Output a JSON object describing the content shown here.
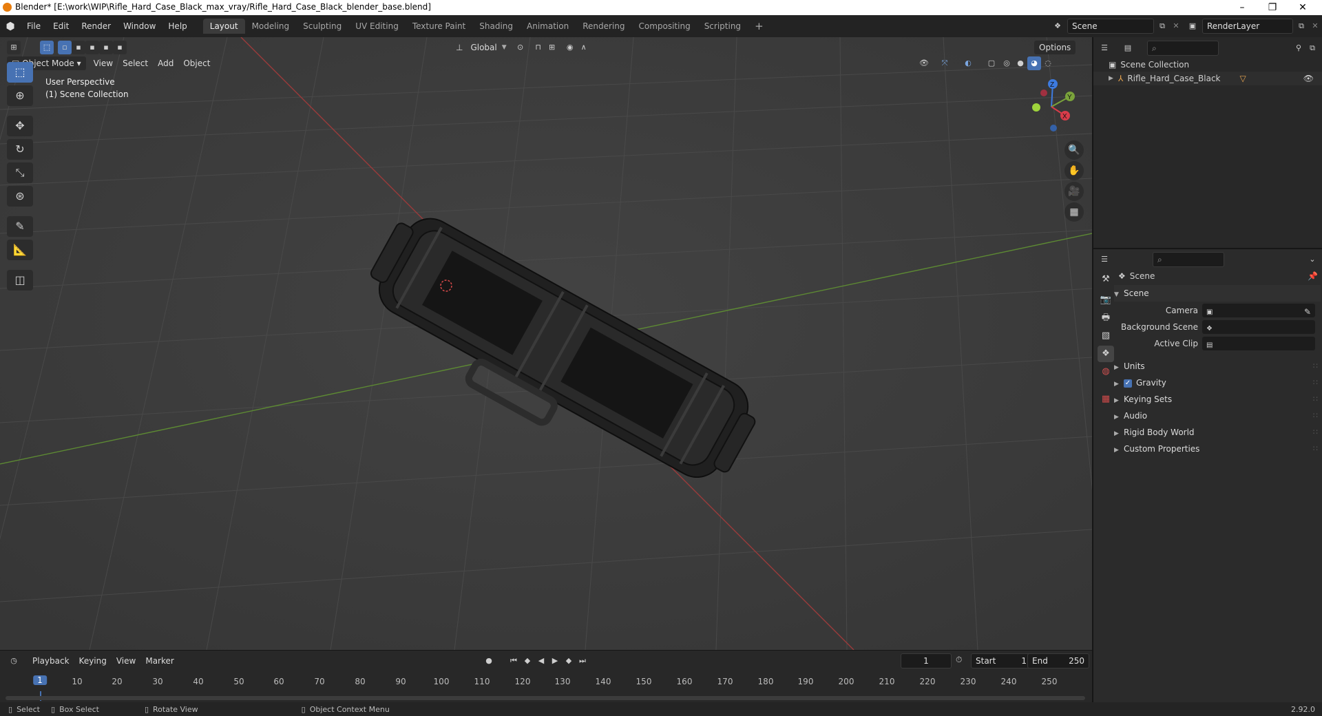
{
  "window": {
    "title": "Blender* [E:\\work\\WIP\\Rifle_Hard_Case_Black_max_vray/Rifle_Hard_Case_Black_blender_base.blend]",
    "minimize": "–",
    "restore": "❐",
    "close": "✕"
  },
  "menus": [
    "File",
    "Edit",
    "Render",
    "Window",
    "Help"
  ],
  "workspaces": {
    "tabs": [
      "Layout",
      "Modeling",
      "Sculpting",
      "UV Editing",
      "Texture Paint",
      "Shading",
      "Animation",
      "Rendering",
      "Compositing",
      "Scripting"
    ],
    "active": "Layout",
    "add": "+"
  },
  "scene_selector": {
    "value": "Scene"
  },
  "render_layer_selector": {
    "value": "RenderLayer"
  },
  "viewport": {
    "mode": "Object Mode",
    "header_menus": [
      "View",
      "Select",
      "Add",
      "Object"
    ],
    "orientation": "Global",
    "options": "Options",
    "info_line1": "User Perspective",
    "info_line2": "(1) Scene Collection",
    "gizmo": {
      "x": "X",
      "y": "Y",
      "z": "Z"
    }
  },
  "outliner": {
    "root": "Scene Collection",
    "items": [
      {
        "label": "Rifle_Hard_Case_Black"
      }
    ]
  },
  "properties": {
    "breadcrumb": "Scene",
    "section": "Scene",
    "fields": [
      {
        "label": "Camera",
        "value": ""
      },
      {
        "label": "Background Scene",
        "value": ""
      },
      {
        "label": "Active Clip",
        "value": ""
      }
    ],
    "panels": [
      {
        "label": "Units",
        "checkbox": false
      },
      {
        "label": "Gravity",
        "checkbox": true,
        "checked": true
      },
      {
        "label": "Keying Sets",
        "checkbox": false
      },
      {
        "label": "Audio",
        "checkbox": false
      },
      {
        "label": "Rigid Body World",
        "checkbox": false
      },
      {
        "label": "Custom Properties",
        "checkbox": false
      }
    ]
  },
  "timeline": {
    "menus": [
      "Playback",
      "Keying",
      "View",
      "Marker"
    ],
    "current_frame": "1",
    "start_label": "Start",
    "start": "1",
    "end_label": "End",
    "end": "250",
    "ticks": [
      "1",
      "10",
      "20",
      "30",
      "40",
      "50",
      "60",
      "70",
      "80",
      "90",
      "100",
      "110",
      "120",
      "130",
      "140",
      "150",
      "160",
      "170",
      "180",
      "190",
      "200",
      "210",
      "220",
      "230",
      "240",
      "250"
    ]
  },
  "statusbar": {
    "select": "Select",
    "box_select": "Box Select",
    "rotate_view": "Rotate View",
    "context_menu": "Object Context Menu",
    "version": "2.92.0"
  }
}
